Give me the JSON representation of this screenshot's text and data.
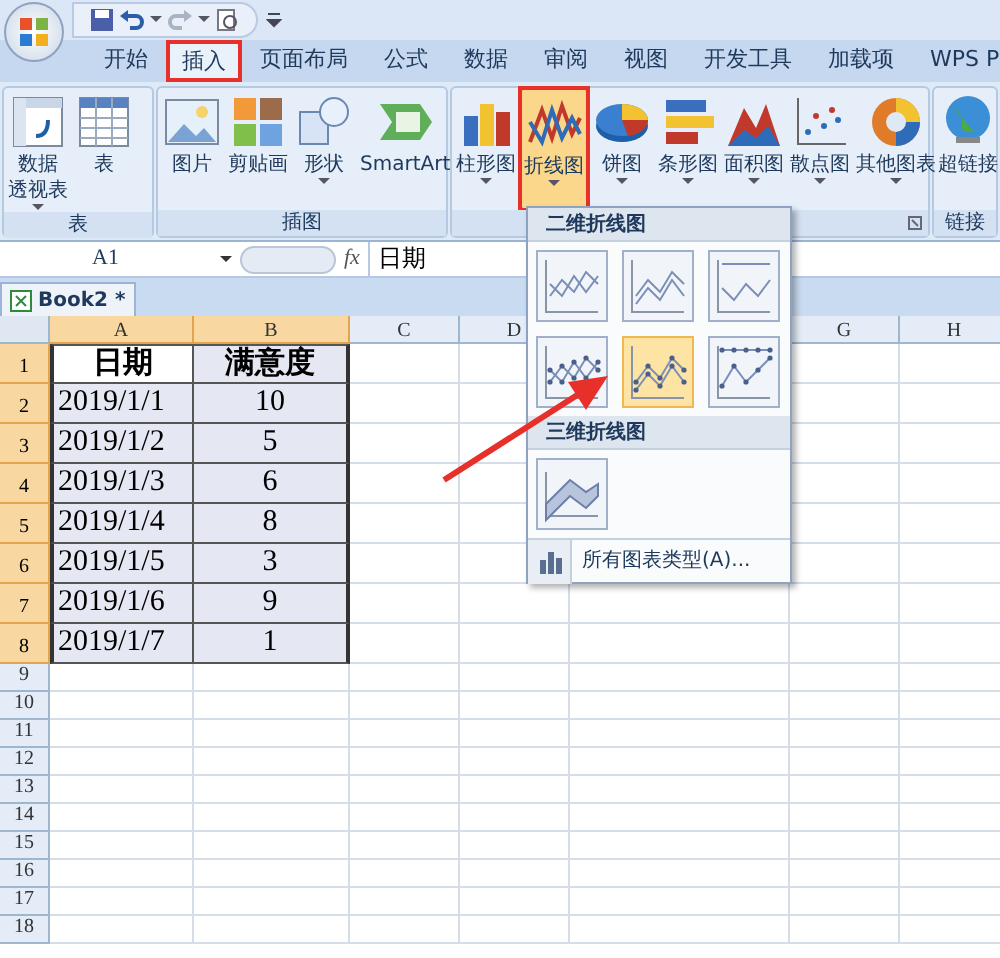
{
  "tabs": [
    {
      "label": "开始",
      "selected": false
    },
    {
      "label": "插入",
      "selected": true
    },
    {
      "label": "页面布局",
      "selected": false
    },
    {
      "label": "公式",
      "selected": false
    },
    {
      "label": "数据",
      "selected": false
    },
    {
      "label": "审阅",
      "selected": false
    },
    {
      "label": "视图",
      "selected": false
    },
    {
      "label": "开发工具",
      "selected": false
    },
    {
      "label": "加载项",
      "selected": false
    },
    {
      "label": "WPS P",
      "selected": false
    }
  ],
  "ribbon": {
    "groups": [
      {
        "label": "表",
        "buttons": [
          {
            "kind": "pivot",
            "lines": [
              "数据",
              "透视表"
            ],
            "dropdown": true,
            "selected": false
          },
          {
            "kind": "table",
            "lines": [
              "表"
            ],
            "dropdown": false,
            "selected": false
          }
        ]
      },
      {
        "label": "插图",
        "buttons": [
          {
            "kind": "picture",
            "lines": [
              "图片"
            ],
            "dropdown": false,
            "selected": false
          },
          {
            "kind": "clipart",
            "lines": [
              "剪贴画"
            ],
            "dropdown": false,
            "selected": false
          },
          {
            "kind": "shapes",
            "lines": [
              "形状"
            ],
            "dropdown": true,
            "selected": false
          },
          {
            "kind": "smartart",
            "lines": [
              "SmartArt"
            ],
            "dropdown": false,
            "selected": false
          }
        ]
      },
      {
        "buttons": [
          {
            "kind": "column",
            "lines": [
              "柱形图"
            ],
            "dropdown": true,
            "selected": false
          },
          {
            "kind": "line",
            "lines": [
              "折线图"
            ],
            "dropdown": true,
            "selected": true
          },
          {
            "kind": "pie",
            "lines": [
              "饼图"
            ],
            "dropdown": true,
            "selected": false
          },
          {
            "kind": "bar",
            "lines": [
              "条形图"
            ],
            "dropdown": true,
            "selected": false
          },
          {
            "kind": "area",
            "lines": [
              "面积图"
            ],
            "dropdown": true,
            "selected": false
          },
          {
            "kind": "scatter",
            "lines": [
              "散点图"
            ],
            "dropdown": true,
            "selected": false
          },
          {
            "kind": "other",
            "lines": [
              "其他图表"
            ],
            "dropdown": true,
            "selected": false
          }
        ]
      },
      {
        "label": "链接",
        "buttons": [
          {
            "kind": "hyperlink",
            "lines": [
              "超链接"
            ],
            "dropdown": false,
            "selected": false
          }
        ]
      }
    ]
  },
  "formula_bar": {
    "name_box": "A1",
    "function_label": "fx",
    "value": "日期"
  },
  "workbook_tab": "Book2 *",
  "columns": [
    {
      "label": "A",
      "selected": true
    },
    {
      "label": "B",
      "selected": true
    },
    {
      "label": "C",
      "selected": false
    },
    {
      "label": "D",
      "selected": false
    },
    {
      "label": "G",
      "selected": false
    },
    {
      "label": "H",
      "selected": false
    }
  ],
  "rows": [
    {
      "label": "1",
      "selected": true,
      "cells": [
        "日期",
        "满意度"
      ]
    },
    {
      "label": "2",
      "selected": true,
      "cells": [
        "2019/1/1",
        "10"
      ]
    },
    {
      "label": "3",
      "selected": true,
      "cells": [
        "2019/1/2",
        "5"
      ]
    },
    {
      "label": "4",
      "selected": true,
      "cells": [
        "2019/1/3",
        "6"
      ]
    },
    {
      "label": "5",
      "selected": true,
      "cells": [
        "2019/1/4",
        "8"
      ]
    },
    {
      "label": "6",
      "selected": true,
      "cells": [
        "2019/1/5",
        "3"
      ]
    },
    {
      "label": "7",
      "selected": true,
      "cells": [
        "2019/1/6",
        "9"
      ]
    },
    {
      "label": "8",
      "selected": true,
      "cells": [
        "2019/1/7",
        "1"
      ]
    },
    {
      "label": "9",
      "selected": false,
      "cells": []
    },
    {
      "label": "10",
      "selected": false,
      "cells": []
    },
    {
      "label": "11",
      "selected": false,
      "cells": []
    },
    {
      "label": "12",
      "selected": false,
      "cells": []
    },
    {
      "label": "13",
      "selected": false,
      "cells": []
    },
    {
      "label": "14",
      "selected": false,
      "cells": []
    },
    {
      "label": "15",
      "selected": false,
      "cells": []
    },
    {
      "label": "16",
      "selected": false,
      "cells": []
    },
    {
      "label": "17",
      "selected": false,
      "cells": []
    },
    {
      "label": "18",
      "selected": false,
      "cells": []
    }
  ],
  "chart_menu": {
    "sections": [
      {
        "title": "二维折线图",
        "options": [
          {
            "kind": "line",
            "selected": false
          },
          {
            "kind": "stacked",
            "selected": false
          },
          {
            "kind": "percent",
            "selected": false
          },
          {
            "kind": "line-markers",
            "selected": false
          },
          {
            "kind": "stacked-markers",
            "selected": true
          },
          {
            "kind": "percent-markers",
            "selected": false
          }
        ]
      },
      {
        "title": "三维折线图",
        "options": [
          {
            "kind": "surface",
            "selected": false
          }
        ]
      }
    ],
    "footer": "所有图表类型(A)..."
  }
}
